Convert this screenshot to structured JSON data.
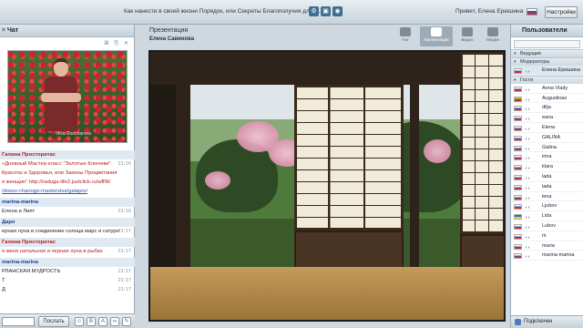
{
  "topbar": {
    "title": "Как нанести в своей жизни Порядок, или Секреты Благополучия для ж...",
    "greeting": "Привет, Елена Ерюшина",
    "settings_label": "Настройки"
  },
  "chat": {
    "header": "Чат",
    "video_watermark": "Vera Goncharova",
    "messages": [
      {
        "kind": "name",
        "text": "Галина Просторитас",
        "color": "red"
      },
      {
        "kind": "text",
        "text": "«Дневный Мастер-класс \"Золотые Ключики\"",
        "time": "21:16",
        "color": "red"
      },
      {
        "kind": "text",
        "text": "Красоты и Здоровья, или Законы Процветания",
        "color": "red"
      },
      {
        "kind": "text",
        "text": "я женщин\" http://raduga-life2.justclick.ru/wff9t/",
        "color": "red"
      },
      {
        "kind": "link",
        "text": "/dosov-chanogo-masterstva/galapro/"
      },
      {
        "kind": "name",
        "text": "marina-marina"
      },
      {
        "kind": "text",
        "text": "Елена и Липт",
        "time": "21:16"
      },
      {
        "kind": "name",
        "text": "Даро"
      },
      {
        "kind": "text",
        "text": "ерная луна в соединение солнца марс и сатурн",
        "time": "21:17"
      },
      {
        "kind": "name",
        "text": "Галина Просторитас",
        "color": "red"
      },
      {
        "kind": "text",
        "text": "я меня натальная и черная луна в рыбах",
        "time": "21:17",
        "color": "red"
      },
      {
        "kind": "name",
        "text": "marina-marina"
      },
      {
        "kind": "text",
        "text": "РЛАНСКАЯ МУДРОСТЬ",
        "time": "21:17"
      },
      {
        "kind": "text",
        "text": "Т",
        "time": "21:17"
      },
      {
        "kind": "text",
        "text": "Д",
        "time": "21:17"
      }
    ],
    "send_label": "Послать",
    "input_value": ""
  },
  "presentation": {
    "title": "Презентация",
    "owner": "Елена Савинова",
    "modes": [
      {
        "label": "Чат",
        "active": false
      },
      {
        "label": "Презентация",
        "active": true
      },
      {
        "label": "Видео",
        "active": false
      },
      {
        "label": "Медиа",
        "active": false
      }
    ]
  },
  "users": {
    "header": "Пользователи",
    "groups": [
      {
        "name": "Ведущие",
        "users": []
      },
      {
        "name": "Модераторы",
        "users": [
          {
            "name": "Елена Ерюшина",
            "flag": "ru"
          }
        ]
      },
      {
        "name": "Гости",
        "users": [
          {
            "name": "Anna Vlady",
            "flag": "ru"
          },
          {
            "name": "Augustinas",
            "flag": "lt"
          },
          {
            "name": "dilja",
            "flag": "ru"
          },
          {
            "name": "eana",
            "flag": "ru"
          },
          {
            "name": "Elena",
            "flag": "ru"
          },
          {
            "name": "GALINA",
            "flag": "ru"
          },
          {
            "name": "Galina",
            "flag": "ru"
          },
          {
            "name": "irina",
            "flag": "ru"
          },
          {
            "name": "klara",
            "flag": "ru"
          },
          {
            "name": "lada",
            "flag": "ru"
          },
          {
            "name": "lada",
            "flag": "ru"
          },
          {
            "name": "lena",
            "flag": "ru"
          },
          {
            "name": "Ljubov",
            "flag": "ru"
          },
          {
            "name": "Lida",
            "flag": "ua"
          },
          {
            "name": "Lubov",
            "flag": "ru"
          },
          {
            "name": "m",
            "flag": "ru"
          },
          {
            "name": "maria",
            "flag": "ru"
          },
          {
            "name": "marina-marina",
            "flag": "ru"
          }
        ]
      }
    ],
    "footer": "Подключен"
  }
}
